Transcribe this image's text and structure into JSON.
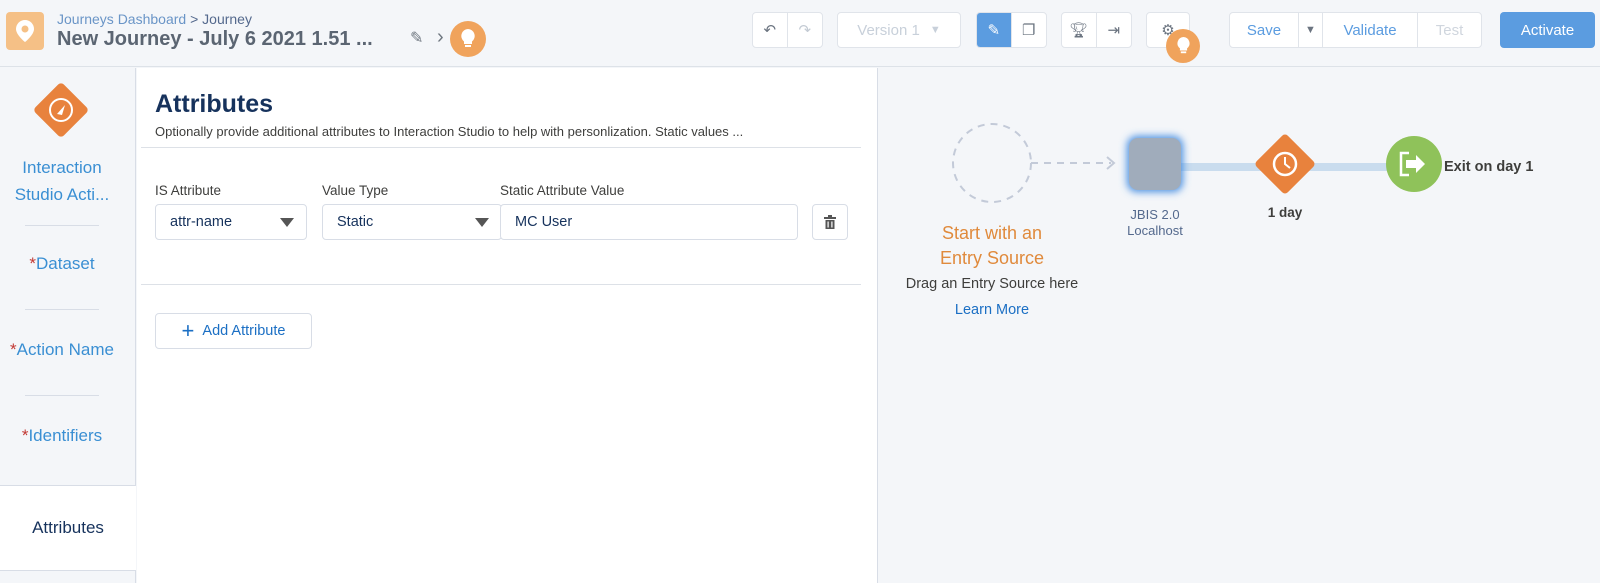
{
  "header": {
    "breadcrumb_link": "Journeys Dashboard",
    "breadcrumb_sep": ">",
    "breadcrumb_current": "Journey",
    "title": "New Journey - July 6 2021 1.51 ...",
    "version": "Version 1",
    "save": "Save",
    "validate": "Validate",
    "test": "Test",
    "activate": "Activate"
  },
  "leftnav": {
    "activity_name": "Interaction Studio Acti...",
    "items": [
      {
        "label": "Dataset",
        "required": "*"
      },
      {
        "label": "Action Name",
        "required": "*"
      },
      {
        "label": "Identifiers",
        "required": "*"
      }
    ],
    "active": "Attributes"
  },
  "panel": {
    "title": "Attributes",
    "description": "Optionally provide additional attributes to Interaction Studio to help with personlization. Static values ...",
    "labels": {
      "is_attribute": "IS Attribute",
      "value_type": "Value Type",
      "static_value": "Static Attribute Value"
    },
    "row": {
      "is_attribute": "attr-name",
      "value_type": "Static",
      "static_value": "MC User"
    },
    "add_button": "Add Attribute"
  },
  "canvas": {
    "entry_title_1": "Start with an",
    "entry_title_2": "Entry Source",
    "entry_hint": "Drag an Entry Source here",
    "learn_more": "Learn More",
    "activity_label_1": "JBIS 2.0",
    "activity_label_2": "Localhost",
    "wait_label": "1 day",
    "exit_label": "Exit on day 1"
  }
}
